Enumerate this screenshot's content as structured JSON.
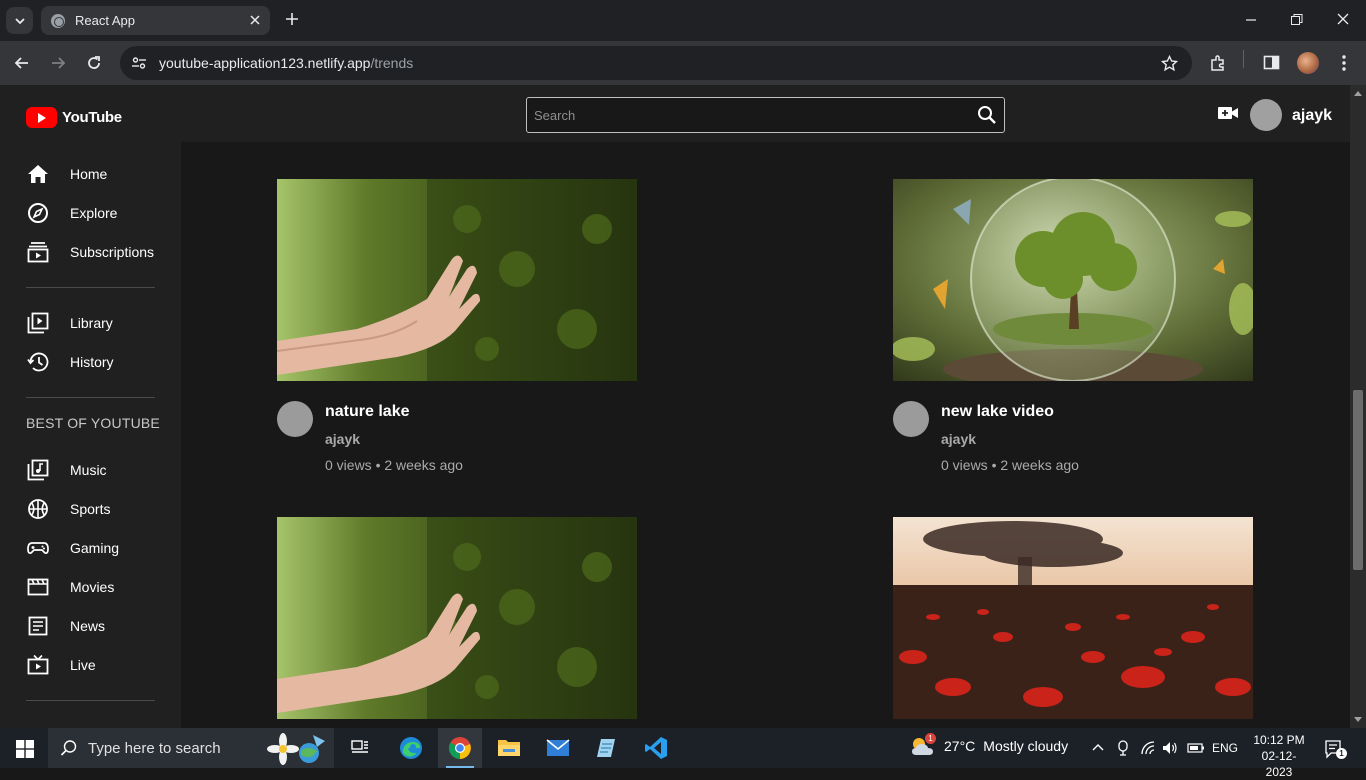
{
  "browser": {
    "tab_title": "React App",
    "url_host": "youtube-application123.netlify.app",
    "url_path": "/trends"
  },
  "app": {
    "logo_text": "YouTube",
    "search_placeholder": "Search",
    "username": "ajayk"
  },
  "sidebar": {
    "primary": [
      {
        "label": "Home",
        "icon": "home-icon"
      },
      {
        "label": "Explore",
        "icon": "explore-icon"
      },
      {
        "label": "Subscriptions",
        "icon": "subscriptions-icon"
      }
    ],
    "library": [
      {
        "label": "Library",
        "icon": "library-icon"
      },
      {
        "label": "History",
        "icon": "history-icon"
      }
    ],
    "section_title": "BEST OF YOUTUBE",
    "best": [
      {
        "label": "Music",
        "icon": "music-icon"
      },
      {
        "label": "Sports",
        "icon": "sports-icon"
      },
      {
        "label": "Gaming",
        "icon": "gaming-icon"
      },
      {
        "label": "Movies",
        "icon": "movies-icon"
      },
      {
        "label": "News",
        "icon": "news-icon"
      },
      {
        "label": "Live",
        "icon": "live-icon"
      }
    ]
  },
  "videos": [
    {
      "title": "nature lake",
      "channel": "ajayk",
      "stats": "0 views • 2 weeks ago",
      "thumb": "moss-hand"
    },
    {
      "title": "new lake video",
      "channel": "ajayk",
      "stats": "0 views • 2 weeks ago",
      "thumb": "glass-tree"
    },
    {
      "title": "",
      "channel": "",
      "stats": "",
      "thumb": "moss-hand"
    },
    {
      "title": "",
      "channel": "",
      "stats": "",
      "thumb": "poppy-field"
    }
  ],
  "taskbar": {
    "search_placeholder": "Type here to search",
    "weather_temp": "27°C",
    "weather_cond": "Mostly cloudy",
    "lang": "ENG",
    "time": "10:12 PM",
    "date": "02-12-2023",
    "notif_count": "1",
    "weather_badge": "1"
  },
  "colors": {
    "accent_red": "#ff0000",
    "page_bg": "#181818",
    "bar_bg": "#202020"
  }
}
